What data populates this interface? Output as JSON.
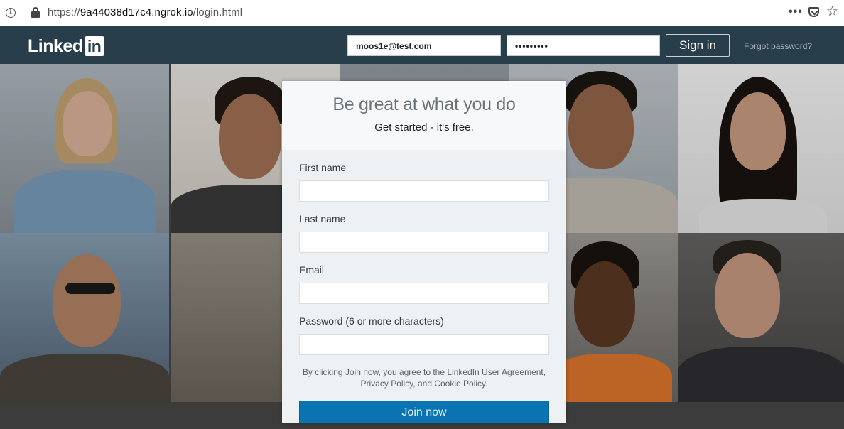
{
  "browser": {
    "url_prefix": "https://",
    "url_host": "9a44038d17c4.ngrok.io",
    "url_path": "/login.html",
    "more_glyph": "•••",
    "star_glyph": "☆"
  },
  "header": {
    "logo_text": "Linked",
    "logo_badge": "in",
    "email_value": "moos1e@test.com",
    "password_value": "•••••••••",
    "signin_label": "Sign in",
    "forgot_label": "Forgot password?"
  },
  "card": {
    "headline": "Be great at what you do",
    "subheadline": "Get started - it's free.",
    "first_name_label": "First name",
    "last_name_label": "Last name",
    "email_label": "Email",
    "password_label": "Password (6 or more characters)",
    "legal_line1": "By clicking Join now, you agree to the LinkedIn User Agreement,",
    "legal_line2": "Privacy Policy, and Cookie Policy.",
    "join_label": "Join now"
  },
  "colors": {
    "header_bg": "#283e4a",
    "join_button": "#0a73b2"
  }
}
